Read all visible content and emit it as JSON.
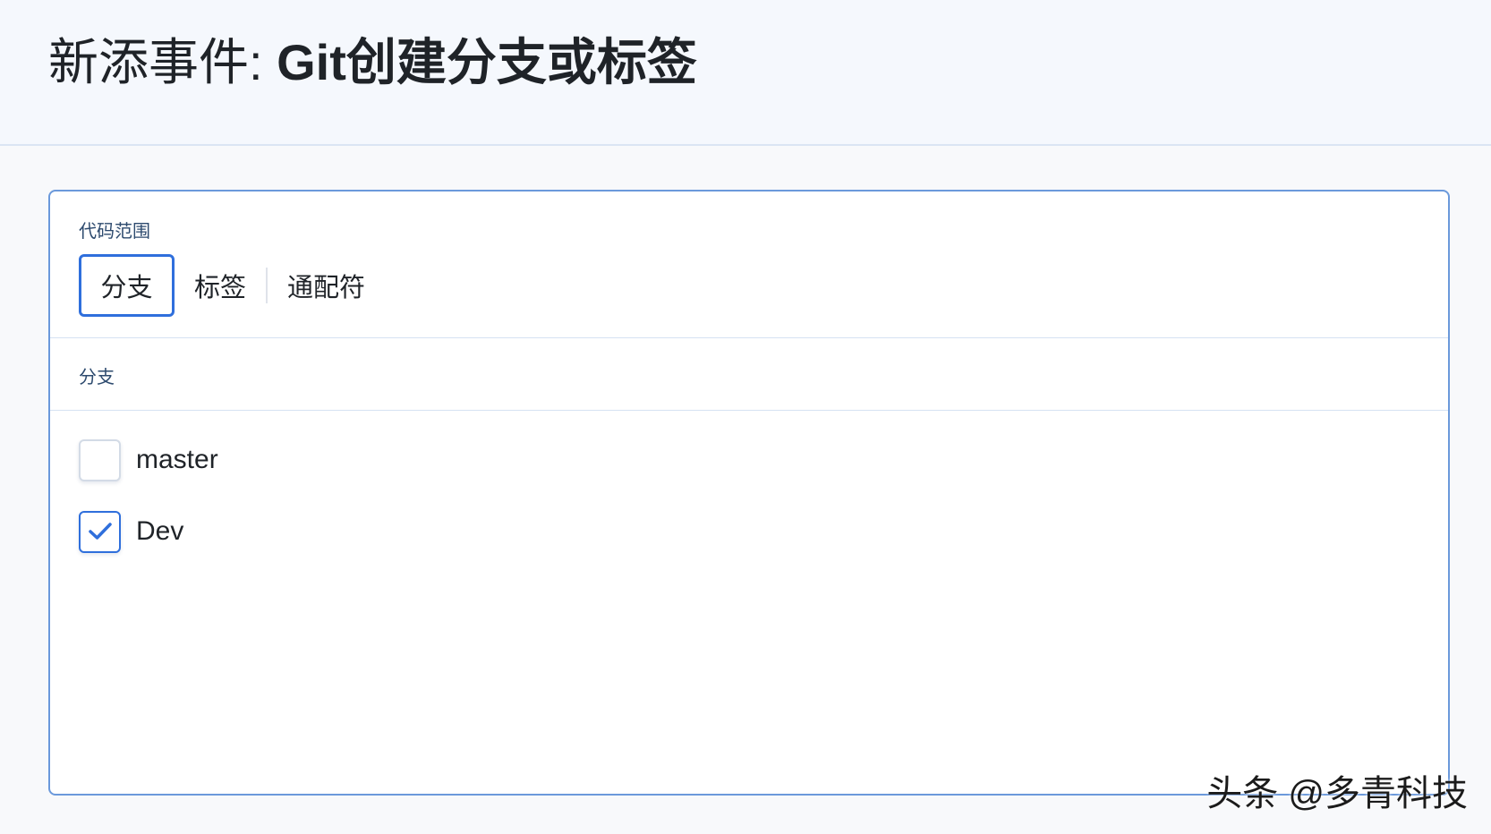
{
  "header": {
    "title_prefix": "新添事件: ",
    "event_name": "Git创建分支或标签"
  },
  "scope": {
    "label": "代码范围",
    "options": [
      {
        "label": "分支",
        "selected": true
      },
      {
        "label": "标签",
        "selected": false
      },
      {
        "label": "通配符",
        "selected": false
      }
    ]
  },
  "branches": {
    "label": "分支",
    "items": [
      {
        "name": "master",
        "checked": false
      },
      {
        "name": "Dev",
        "checked": true
      }
    ]
  },
  "watermark": {
    "text": "头条 @多青科技"
  },
  "colors": {
    "accent": "#2f6fdc",
    "card_border": "#6b99db",
    "header_bg": "#f5f8fd"
  },
  "icons": {
    "checkmark": "checkmark-icon"
  }
}
